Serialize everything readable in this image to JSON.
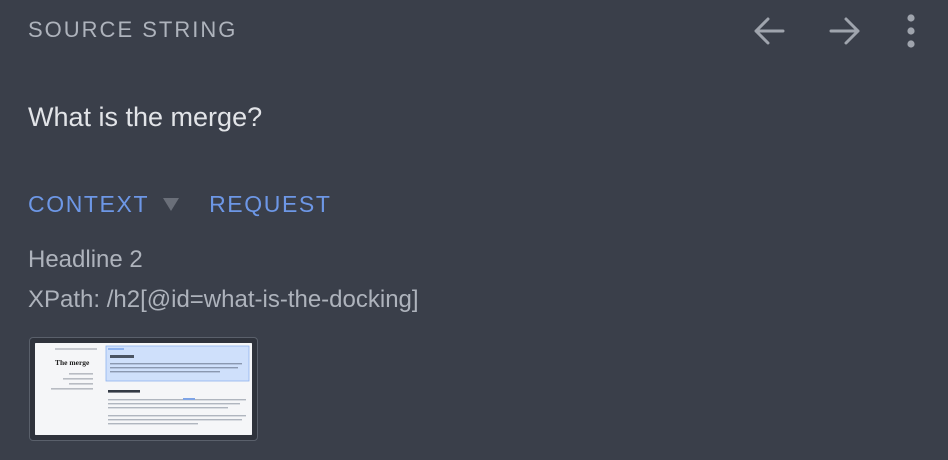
{
  "header": {
    "title": "SOURCE STRING",
    "prev_icon": "arrow-left-icon",
    "next_icon": "arrow-right-icon",
    "more_icon": "more-vertical-icon"
  },
  "source": {
    "text": "What is the merge?"
  },
  "tabs": [
    {
      "label": "CONTEXT",
      "has_dropdown": true
    },
    {
      "label": "REQUEST",
      "has_dropdown": false
    }
  ],
  "context": {
    "element_type": "Headline 2",
    "xpath": "XPath: /h2[@id=what-is-the-docking]"
  },
  "screenshot": {
    "heading": "The merge"
  },
  "colors": {
    "background": "#3a3f4a",
    "accent": "#6d97e6",
    "muted_text": "#aeb3bc",
    "primary_text": "#e2e4e8",
    "icon": "#9fa4ad"
  }
}
